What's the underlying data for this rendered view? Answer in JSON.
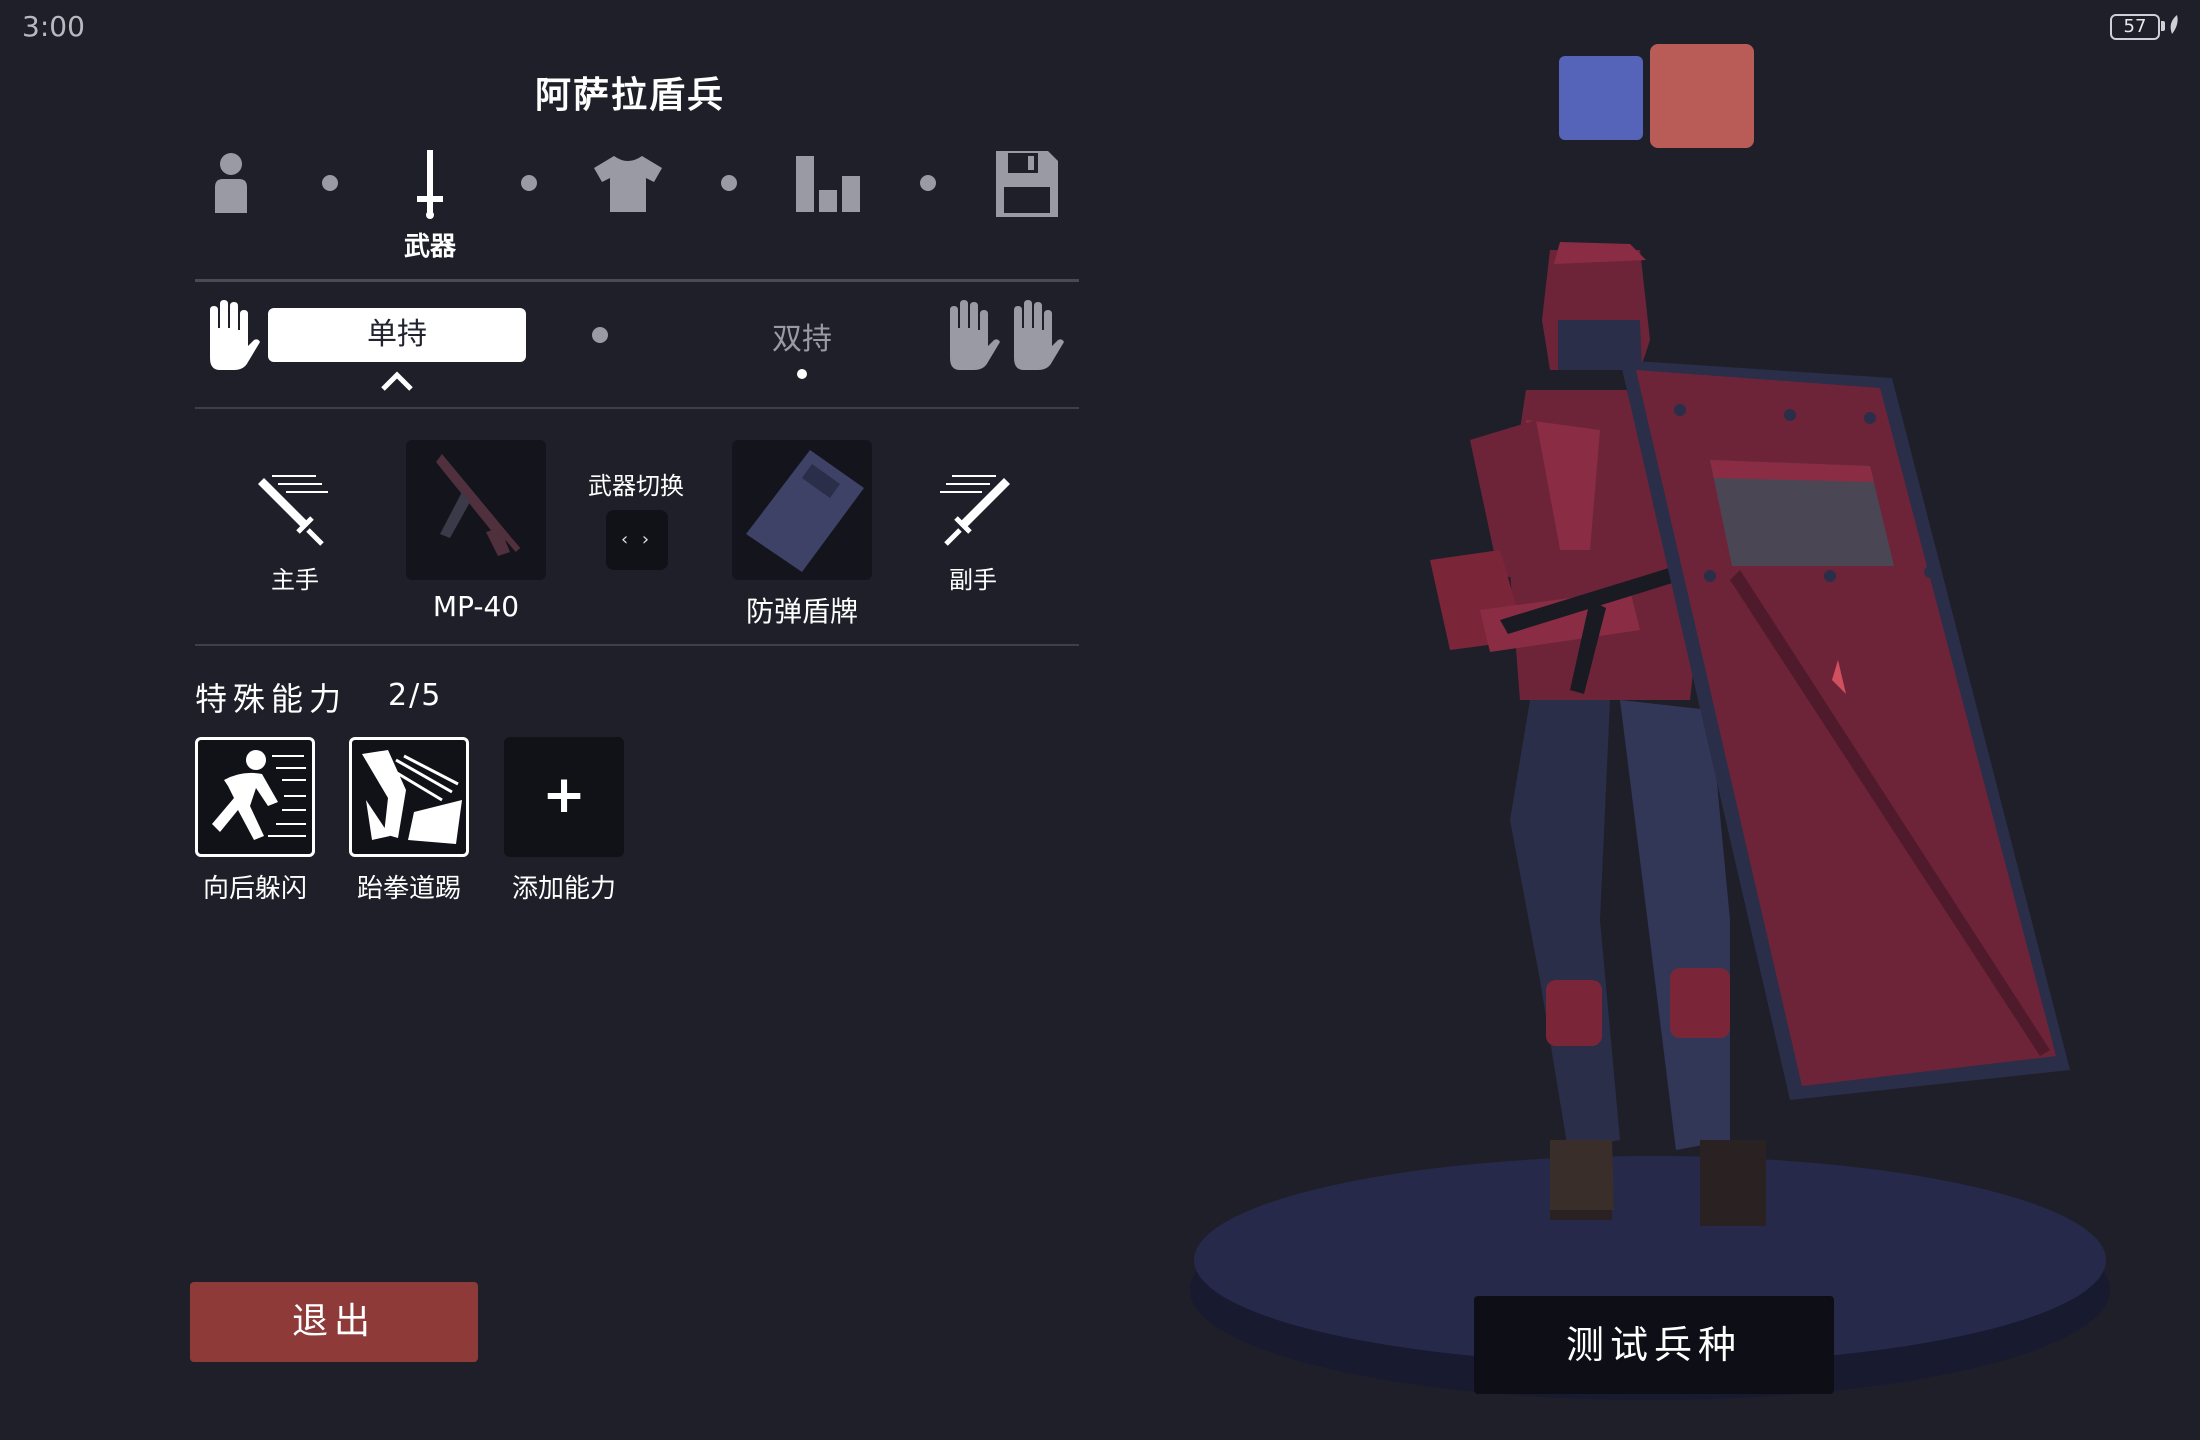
{
  "status": {
    "time": "3:00",
    "battery": "57"
  },
  "unit": {
    "title": "阿萨拉盾兵"
  },
  "steps": {
    "active_label": "武器",
    "items": [
      {
        "icon": "person-icon"
      },
      {
        "icon": "sword-icon"
      },
      {
        "icon": "shirt-icon"
      },
      {
        "icon": "stats-icon"
      },
      {
        "icon": "floppy-save-icon"
      }
    ]
  },
  "grip": {
    "one_handed": "单持",
    "two_handed": "双持"
  },
  "weapons": {
    "main_hand_label": "主手",
    "off_hand_label": "副手",
    "primary": "MP-40",
    "secondary": "防弹盾牌",
    "swap_label": "武器切换",
    "swap_glyph": "‹ ›"
  },
  "abilities": {
    "title": "特殊能力",
    "count": "2/5",
    "items": [
      {
        "label": "向后躲闪",
        "icon": "backstep-dodge-icon"
      },
      {
        "label": "跆拳道踢",
        "icon": "taekwondo-kick-icon"
      }
    ],
    "add_label": "添加能力",
    "add_glyph": "+"
  },
  "exit_label": "退出",
  "test_label": "测试兵种",
  "colors": {
    "background": "#1f1f2a",
    "team_blue": "#5563b8",
    "team_red": "#b95c58",
    "exit_button": "#8e3a38",
    "unit_red": "#6e2438"
  }
}
